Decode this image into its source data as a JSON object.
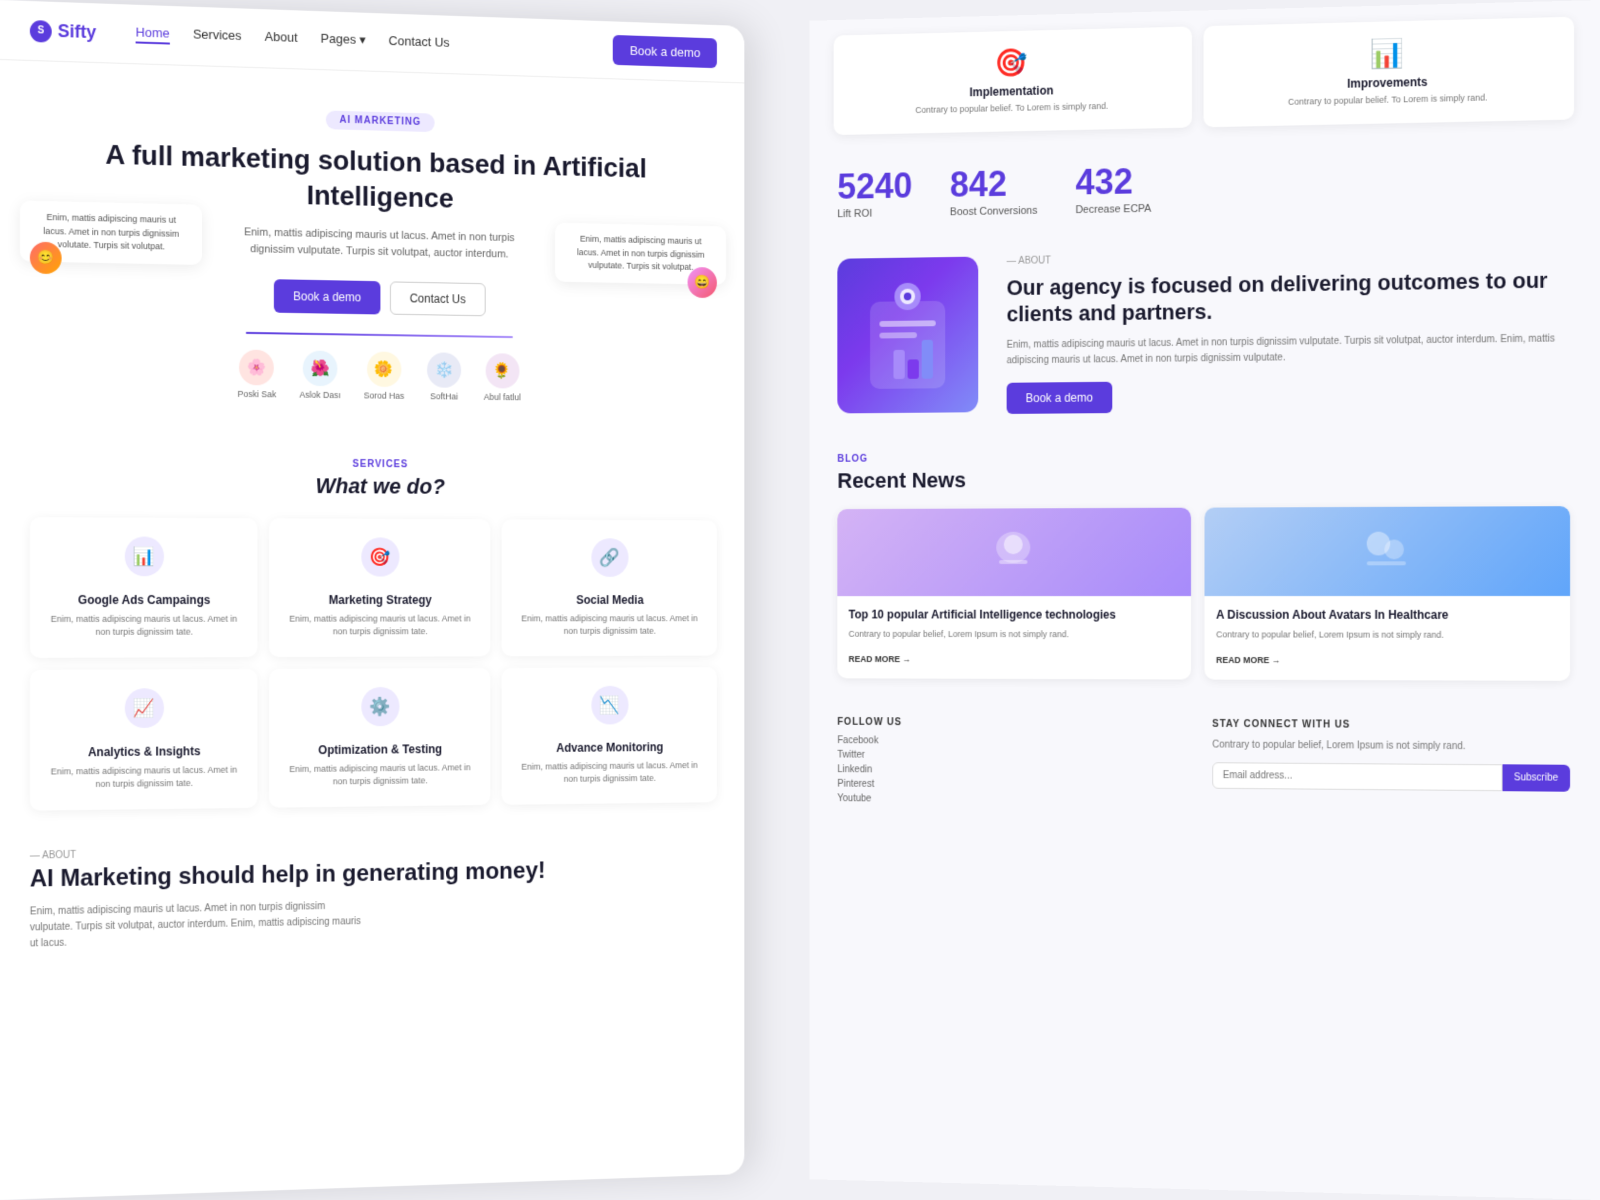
{
  "nav": {
    "logo": "Sifty",
    "links": [
      "Home",
      "Services",
      "About",
      "Pages",
      "Contact Us"
    ],
    "active": "Home",
    "book_btn": "Book a demo"
  },
  "hero": {
    "badge": "AI MARKETING",
    "title": "A full marketing solution based in Artificial Intelligence",
    "subtitle": "Enim, mattis adipiscing mauris ut lacus. Amet in non turpis dignissim vulputate. Turpis sit volutpat, auctor interdum.",
    "btn_primary": "Book a demo",
    "btn_outline": "Contact Us"
  },
  "avatars": [
    {
      "name": "Poski Sak",
      "emoji": "🌸"
    },
    {
      "name": "Aslok Dası",
      "emoji": "🌺"
    },
    {
      "name": "Sorod Has",
      "emoji": "🌼"
    },
    {
      "name": "SoftHai",
      "emoji": "❄️"
    },
    {
      "name": "Abul fatlul",
      "emoji": "🌻"
    }
  ],
  "testimonials": {
    "left": "Enim, mattis adipiscing mauris ut lacus. Amet in non turpis dignissim volutate. Turpis sit volutpat.",
    "right": "Enim, mattis adipiscing mauris ut lacus. Amet in non turpis dignissim vulputate. Turpis sit volutpat."
  },
  "services": {
    "label": "SERVICES",
    "title": "What we do?",
    "items": [
      {
        "name": "Google Ads Campaings",
        "desc": "Enim, mattis adipiscing mauris ut lacus. Amet in non turpis dignissim tate.",
        "icon": "📊"
      },
      {
        "name": "Marketing Strategy",
        "desc": "Enim, mattis adipiscing mauris ut lacus. Amet in non turpis dignissim tate.",
        "icon": "🎯"
      },
      {
        "name": "Social Media",
        "desc": "Enim, mattis adipiscing mauris ut lacus. Amet in non turpis dignissim tate.",
        "icon": "🔗"
      },
      {
        "name": "Analytics & Insights",
        "desc": "Enim, mattis adipiscing mauris ut lacus. Amet in non turpis dignissim tate.",
        "icon": "📈"
      },
      {
        "name": "Optimization & Testing",
        "desc": "Enim, mattis adipiscing mauris ut lacus. Amet in non turpis dignissim tate.",
        "icon": "⚙️"
      },
      {
        "name": "Advance Monitoring",
        "desc": "Enim, mattis adipiscing mauris ut lacus. Amet in non turpis dignissim tate.",
        "icon": "📉"
      }
    ]
  },
  "about_left": {
    "label": "— ABOUT",
    "title": "AI Marketing should help in generating money!",
    "desc": "Enim, mattis adipiscing mauris ut lacus. Amet in non turpis dignissim vulputate. Turpis sit volutpat, auctor interdum. Enim, mattis adipiscing mauris ut lacus."
  },
  "right_top_cards": [
    {
      "icon": "🎯",
      "title": "Implementation",
      "desc": "Contrary to popular belief. To Lorem is simply rand."
    },
    {
      "icon": "📊",
      "title": "Improvements",
      "desc": "Contrary to popular belief. To Lorem is simply rand."
    }
  ],
  "stats": [
    {
      "number": "5240",
      "label": "Lift ROI"
    },
    {
      "number": "842",
      "label": "Boost Conversions"
    },
    {
      "number": "432",
      "label": "Decrease ECPA"
    }
  ],
  "about_right": {
    "label": "— ABOUT",
    "title": "Our agency is focused on delivering outcomes to our clients and partners.",
    "desc": "Enim, mattis adipiscing mauris ut lacus. Amet in non turpis dignissim vulputate. Turpis sit volutpat, auctor interdum. Enim, mattis adipiscing mauris ut lacus. Amet in non turpis dignissim vulputate.",
    "btn": "Book a demo"
  },
  "blog": {
    "label": "BLOG",
    "title": "Recent News",
    "cards": [
      {
        "title": "Top 10 popular Artificial Intelligence technologies",
        "desc": "Contrary to popular belief, Lorem Ipsum is not simply rand.",
        "read_more": "READ MORE",
        "color": "#d4b3f5"
      },
      {
        "title": "A Discussion About Avatars In Healthcare",
        "desc": "Contrary to popular belief, Lorem Ipsum is not simply rand.",
        "read_more": "READ MORE",
        "color": "#b3cef5"
      }
    ]
  },
  "footer": {
    "follow_title": "FOLLOW US",
    "social_links": [
      "Facebook",
      "Twitter",
      "Linkedin",
      "Pinterest",
      "Youtube"
    ],
    "connect_title": "STAY CONNECT WITH US",
    "connect_desc": "Contrary to popular belief, Lorem Ipsum is not simply rand.",
    "email_placeholder": "Email address...",
    "subscribe_btn": "Subscribe"
  }
}
